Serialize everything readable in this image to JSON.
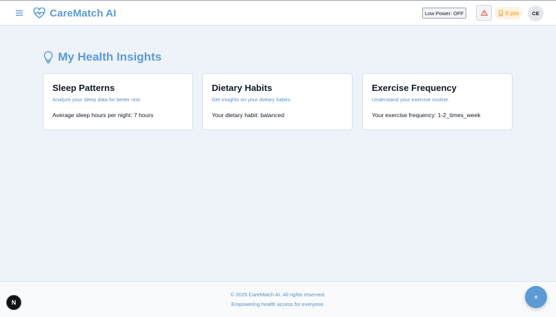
{
  "header": {
    "menu_icon": "hamburger-icon",
    "logo_icon": "heart-pulse-icon",
    "app_name": "CareMatch AI",
    "low_power_label": "Low Power: OFF",
    "alert_icon": "warning-triangle-icon",
    "points_icon": "award-icon",
    "points_label": "0 pts",
    "avatar_initials": "CE"
  },
  "main": {
    "title_icon": "lightbulb-icon",
    "title": "My Health Insights",
    "cards": [
      {
        "title": "Sleep Patterns",
        "subtitle": "Analyze your sleep data for better rest.",
        "body": "Average sleep hours per night: 7 hours"
      },
      {
        "title": "Dietary Habits",
        "subtitle": "Get insights on your dietary habits.",
        "body": "Your dietary habit: balanced"
      },
      {
        "title": "Exercise Frequency",
        "subtitle": "Understand your exercise routine.",
        "body": "Your exercise frequency: 1-2_times_week"
      }
    ]
  },
  "footer": {
    "copyright": "© 2025 CareMatch AI. All rights reserved.",
    "tagline": "Empowering health access for everyone."
  },
  "overlay": {
    "dev_badge_label": "N",
    "fab_label": "+"
  },
  "colors": {
    "accent": "#5b9bd5",
    "background": "#edf3f9",
    "points": "#f4a740",
    "alert": "#e05252"
  }
}
